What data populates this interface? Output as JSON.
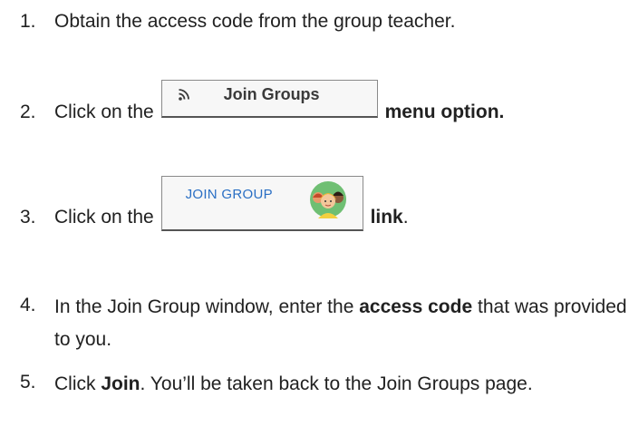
{
  "steps": [
    {
      "number": "1.",
      "text": "Obtain the access code from the group teacher."
    },
    {
      "number": "2.",
      "before": "Click on the",
      "button_label": "Join Groups",
      "button_icon": "rss-feed-icon",
      "after": "menu option."
    },
    {
      "number": "3.",
      "before": "Click on the",
      "link_label": "JOIN GROUP",
      "link_icon": "group-avatar-icon",
      "after": "link",
      "after_punct": "."
    },
    {
      "number": "4.",
      "before": "In the Join Group window, enter the",
      "bold": "access code",
      "after": "that was provided to you."
    },
    {
      "number": "5.",
      "before": "Click",
      "bold": "Join",
      "after": ". You’ll be taken back to the Join Groups page."
    }
  ],
  "colors": {
    "text": "#212121",
    "link": "#2a6fc4",
    "button_border": "#8a8a8a",
    "button_bg": "#f7f7f7",
    "avatar_bg": "#6fbf73"
  }
}
